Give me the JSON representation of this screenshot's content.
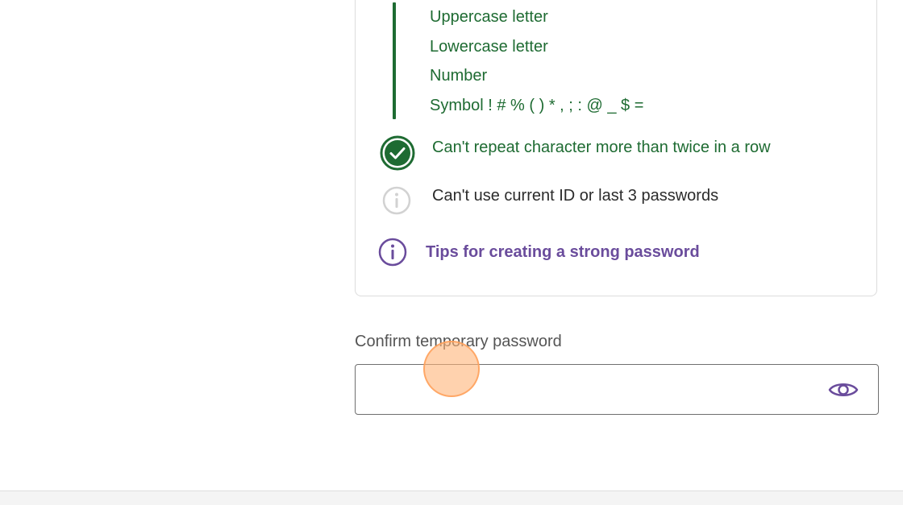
{
  "requirements": {
    "sub_items": [
      "Uppercase letter",
      "Lowercase letter",
      "Number",
      "Symbol ! # % ( ) * , ; : @ _ $ ="
    ],
    "rules": [
      {
        "text": "Can't repeat character more than twice in a row",
        "status": "met",
        "icon": "check-circle-icon"
      },
      {
        "text": "Can't use current ID or last 3 passwords",
        "status": "unmet",
        "icon": "info-icon"
      }
    ],
    "tips_link": "Tips for creating a strong password"
  },
  "confirm_field": {
    "label": "Confirm temporary password",
    "value": "",
    "placeholder": "",
    "toggle_icon": "eye-icon"
  },
  "colors": {
    "success": "#1e6b32",
    "accent": "#6a4c9c",
    "muted": "#cfcfcf"
  }
}
